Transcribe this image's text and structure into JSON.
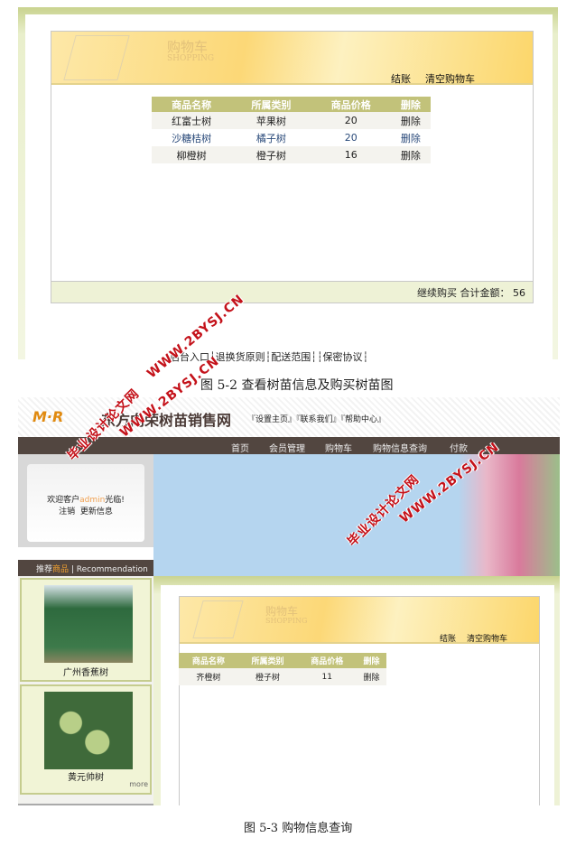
{
  "figure1": {
    "cart_title": "购物车",
    "cart_subtitle": "SHOPPING",
    "links": {
      "checkout": "结账",
      "clear": "清空购物车"
    },
    "columns": [
      "商品名称",
      "所属类别",
      "商品价格",
      "删除"
    ],
    "rows": [
      [
        "红富士树",
        "苹果树",
        "20",
        "删除"
      ],
      [
        "沙糖桔树",
        "橘子树",
        "20",
        "删除"
      ],
      [
        "柳橙树",
        "橙子树",
        "16",
        "删除"
      ]
    ],
    "continue": "继续购买",
    "total_label": "合计金额：",
    "total": "56",
    "footer_links": "后台入口┆退换货原则┆配送范围┆┆保密协议┆",
    "caption": "图 5-2   查看树苗信息及购买树苗图"
  },
  "figure2": {
    "logo": "M·R",
    "site_title": "东方向荣树苗销售网",
    "top_links": "『设置主页』『联系我们』『帮助中心』",
    "nav": [
      "首页",
      "会员管理",
      "购物车",
      "购物信息查询",
      "付款"
    ],
    "welcome_prefix": "欢迎客户",
    "username": "admin",
    "welcome_suffix": "光临!",
    "logout": "注销",
    "update": "更新信息",
    "rec_a": "推荐",
    "rec_b": "商品",
    "rec_c": "| Recommendation",
    "products": [
      "广州香蕉树",
      "黄元帅树"
    ],
    "more": "more",
    "cart_title": "购物车",
    "cart_subtitle": "SHOPPING",
    "links": {
      "checkout": "结账",
      "clear": "清空购物车"
    },
    "columns": [
      "商品名称",
      "所属类别",
      "商品价格",
      "删除"
    ],
    "rows": [
      [
        "齐橙树",
        "橙子树",
        "11",
        "删除"
      ]
    ],
    "caption": "图 5-3    购物信息查询"
  },
  "watermark": {
    "line1": "毕业设计论文网",
    "line2": "WWW.2BYSJ.CN"
  }
}
